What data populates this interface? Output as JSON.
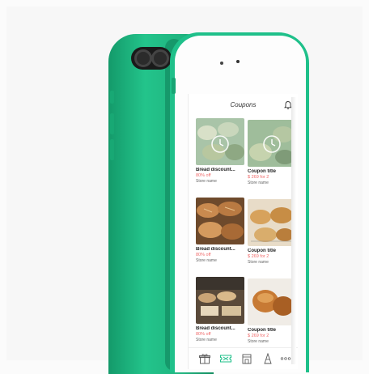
{
  "app": {
    "title": "Coupons"
  },
  "coupons": [
    {
      "title": "Bread discount...",
      "price": "80% off",
      "store": "Store name",
      "image": "pastry-timer-image"
    },
    {
      "title": "Coupon title",
      "price": "$ 269 for 2",
      "store": "Store name",
      "image": "pastry-timer-image"
    },
    {
      "title": "Bread discount...",
      "price": "80% off",
      "store": "Store name",
      "image": "bread-loaves-image"
    },
    {
      "title": "Coupon title",
      "price": "$ 269 for 2",
      "store": "Store name",
      "image": "croissants-image"
    },
    {
      "title": "Bread discount...",
      "price": "80% off",
      "store": "Store name",
      "image": "bakery-counter-image"
    },
    {
      "title": "Coupon title",
      "price": "$ 269 for 2",
      "store": "Store name",
      "image": "muffins-image"
    }
  ],
  "tabbar": {
    "items": [
      "gift-icon",
      "coupon-icon",
      "store-icon",
      "tower-icon",
      "more-icon"
    ],
    "active_color": "#1fc08a"
  },
  "colors": {
    "phone_green": "#1fc08a",
    "price_red": "#f06a6a"
  }
}
